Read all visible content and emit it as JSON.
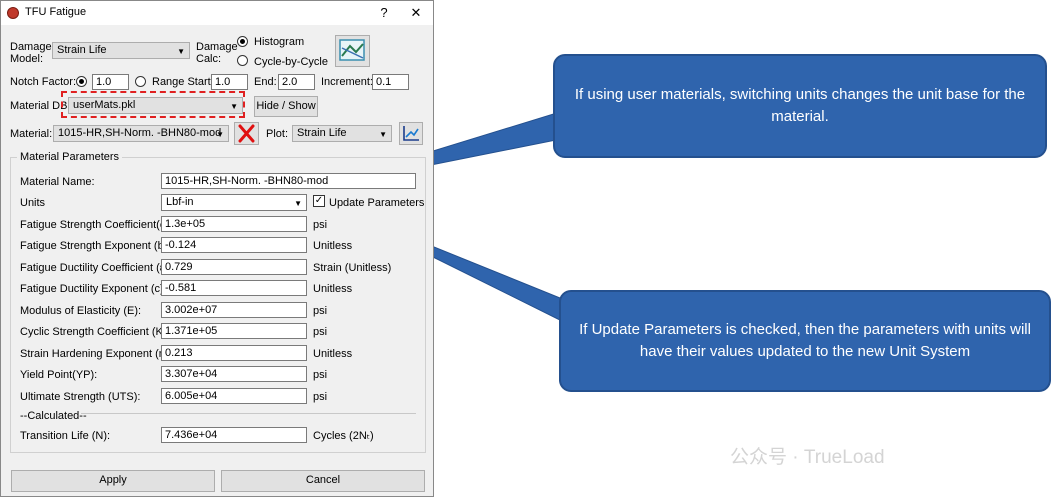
{
  "window": {
    "title": "TFU Fatigue",
    "help_button": "?",
    "close_button": "✕"
  },
  "damage_model": {
    "label_line1": "Damage",
    "label_line2": "Model:",
    "value": "Strain Life"
  },
  "damage_calc": {
    "label_line1": "Damage",
    "label_line2": "Calc:",
    "options": [
      "Histogram",
      "Cycle-by-Cycle"
    ],
    "selected": "Histogram"
  },
  "notch": {
    "notch_label": "Notch Factor:",
    "notch_value": "1.0",
    "range_start_label": "Range Start:",
    "range_start_value": "1.0",
    "end_label": "End:",
    "end_value": "2.0",
    "increment_label": "Increment:",
    "increment_value": "0.1"
  },
  "material_db": {
    "label": "Material DB",
    "value": "userMats.pkl",
    "hide_show_label": "Hide / Show"
  },
  "material": {
    "label": "Material:",
    "value": "1015-HR,SH-Norm. -BHN80-mod",
    "plot_label": "Plot:",
    "plot_value": "Strain Life"
  },
  "params": {
    "group_title": "Material Parameters",
    "material_name_label": "Material Name:",
    "material_name_value": "1015-HR,SH-Norm. -BHN80-mod",
    "units_label": "Units",
    "units_value": "Lbf-in",
    "update_params_label": "Update Parameters",
    "update_params_checked": true,
    "rows": [
      {
        "label": "Fatigue Strength Coefficient(σf′):",
        "value": "1.3e+05",
        "unit": "psi"
      },
      {
        "label": "Fatigue Strength Exponent (b):",
        "value": "-0.124",
        "unit": "Unitless"
      },
      {
        "label": "Fatigue Ductility Coefficient (εf′):",
        "value": "0.729",
        "unit": "Strain (Unitless)"
      },
      {
        "label": "Fatigue Ductility Exponent (c):",
        "value": "-0.581",
        "unit": "Unitless"
      },
      {
        "label": "Modulus of Elasticity (E):",
        "value": "3.002e+07",
        "unit": "psi"
      },
      {
        "label": "Cyclic Strength Coefficient (K'):",
        "value": "1.371e+05",
        "unit": "psi"
      },
      {
        "label": "Strain Hardening Exponent (n'):",
        "value": "0.213",
        "unit": "Unitless"
      },
      {
        "label": "Yield Point(YP):",
        "value": "3.307e+04",
        "unit": "psi"
      },
      {
        "label": "Ultimate Strength (UTS):",
        "value": "6.005e+04",
        "unit": "psi"
      }
    ],
    "calculated_label": "--Calculated--",
    "transition_label": "Transition Life (N):",
    "transition_value": "7.436e+04",
    "transition_unit": "Cycles (2Nₜ)"
  },
  "footer": {
    "apply_label": "Apply",
    "cancel_label": "Cancel"
  },
  "callouts": {
    "units": "If using user materials, switching units changes the unit base for the material.",
    "update": "If Update Parameters is checked, then the parameters with units will have their values updated to the new Unit System"
  },
  "watermark": "公众号 · TrueLoad",
  "colors": {
    "callout_fill": "#2f64ad",
    "highlight_dash": "#e02020"
  }
}
